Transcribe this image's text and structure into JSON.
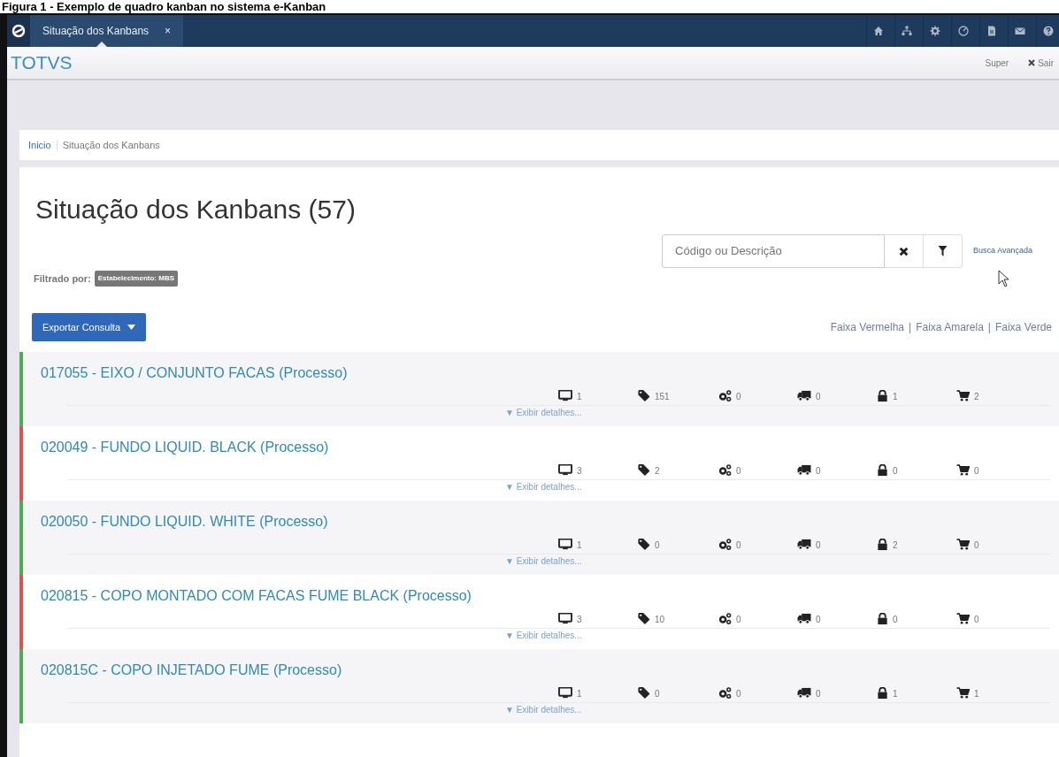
{
  "caption": "Figura 1 - Exemplo de quadro kanban no sistema e-Kanban",
  "tabs": [
    {
      "label": "Situação dos Kanbans",
      "close": "×",
      "selected": true
    }
  ],
  "toolbar_icons": [
    {
      "kind": "home"
    },
    {
      "kind": "sitemap"
    },
    {
      "kind": "gear"
    },
    {
      "kind": "dashboard"
    },
    {
      "kind": "document"
    },
    {
      "kind": "mail"
    },
    {
      "kind": "help"
    }
  ],
  "header": {
    "brand": "TOTVS",
    "user": "Super",
    "logout": "Sair"
  },
  "breadcrumb": [
    {
      "label": "Inicio"
    },
    {
      "label": "Situação dos Kanbans"
    }
  ],
  "page_title": "Situação dos Kanbans (57)",
  "search": {
    "placeholder": "Código ou Descrição",
    "advanced": "Busca Avançada"
  },
  "filter": {
    "label": "Filtrado por:",
    "tag": "Estabelecimento: MBS"
  },
  "export_button": "Exportar Consulta",
  "band_links": [
    {
      "label": "Faixa Vermelha"
    },
    {
      "label": "Faixa Amarela",
      "separator": "|"
    },
    {
      "label": "Faixa Verde",
      "separator": "|"
    }
  ],
  "kanbans": [
    {
      "title": "017055 - EIXO / CONJUNTO FACAS (Processo)",
      "color": "#4cae4c",
      "counts": [
        "1",
        "151",
        "0",
        "0",
        "1",
        "2"
      ],
      "details": "▼ Exibir detalhes..."
    },
    {
      "title": "020049 - FUNDO LIQUID. BLACK (Processo)",
      "color": "#d9534f",
      "counts": [
        "3",
        "2",
        "0",
        "0",
        "0",
        "0"
      ],
      "details": "▼ Exibir detalhes..."
    },
    {
      "title": "020050 - FUNDO LIQUID. WHITE (Processo)",
      "color": "#4cae4c",
      "counts": [
        "1",
        "0",
        "0",
        "0",
        "2",
        "0"
      ],
      "details": "▼ Exibir detalhes..."
    },
    {
      "title": "020815 - COPO MONTADO COM FACAS FUME BLACK (Processo)",
      "color": "#d9534f",
      "counts": [
        "3",
        "10",
        "0",
        "0",
        "0",
        "0"
      ],
      "details": "▼ Exibir detalhes..."
    },
    {
      "title": "020815C - COPO INJETADO FUME (Processo)",
      "color": "#4cae4c",
      "counts": [
        "1",
        "0",
        "0",
        "0",
        "1",
        "1"
      ],
      "details": "▼ Exibir detalhes..."
    }
  ]
}
